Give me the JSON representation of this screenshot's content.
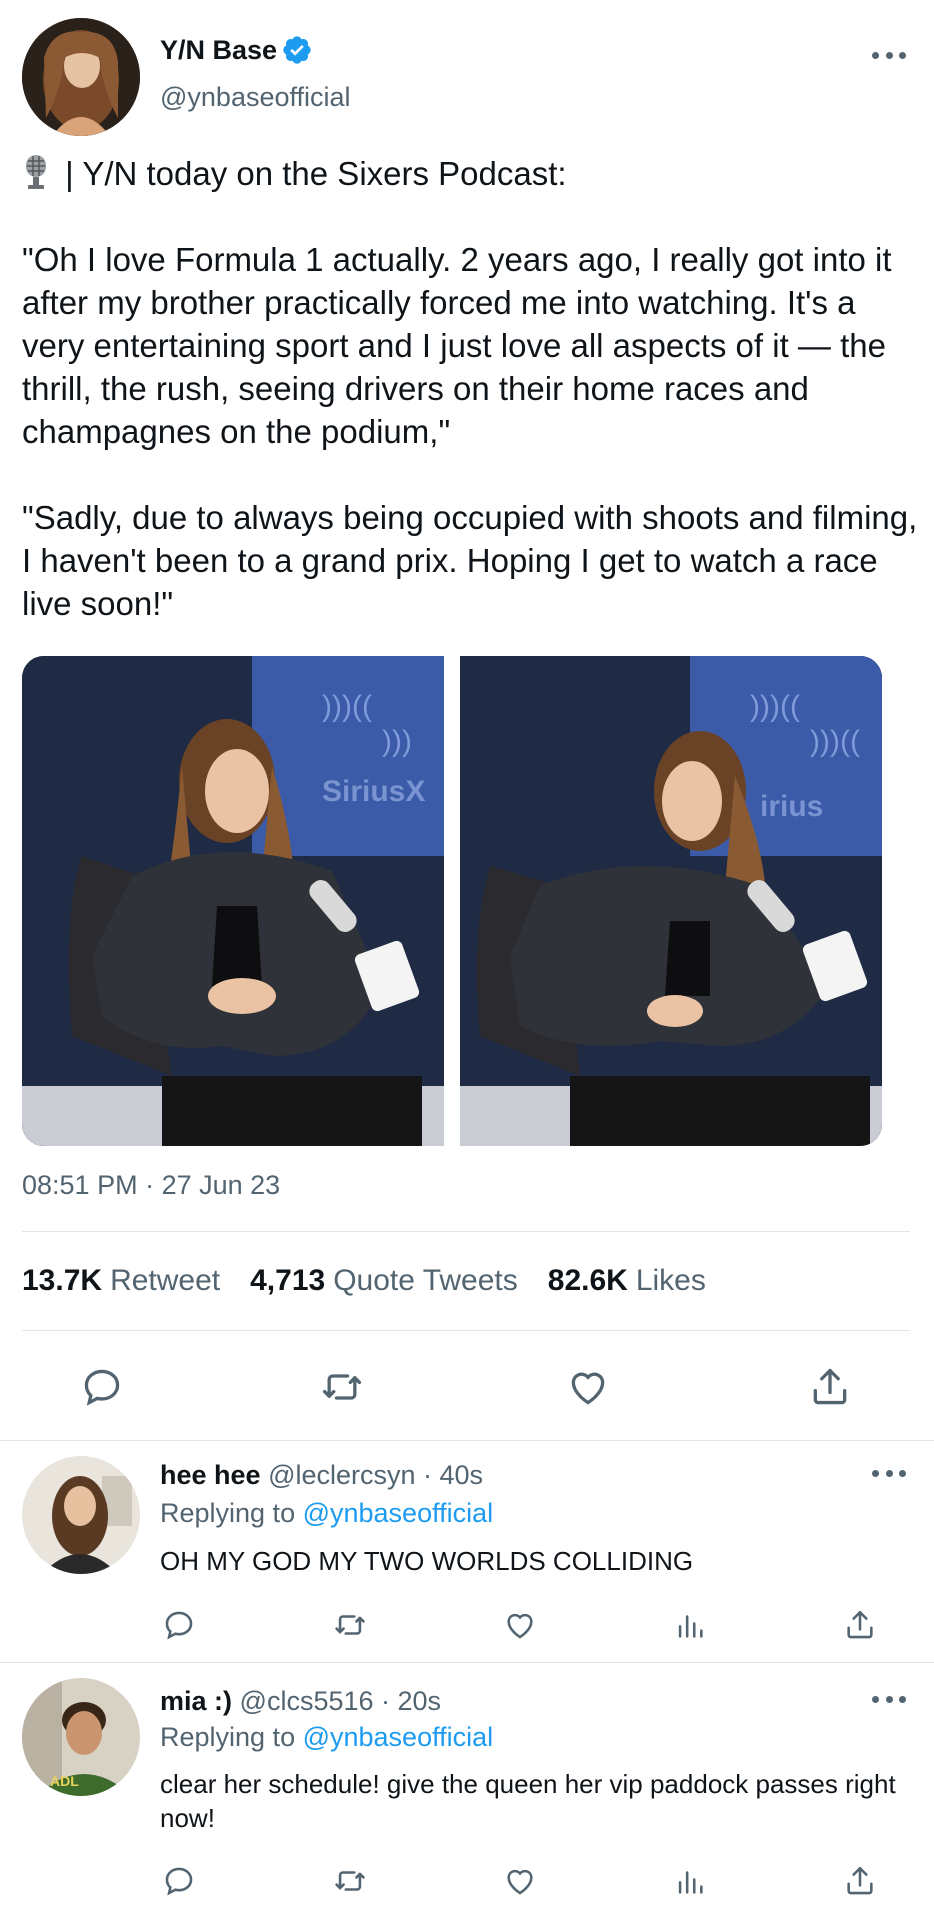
{
  "main_tweet": {
    "display_name": "Y/N Base",
    "handle": "@ynbaseofficial",
    "verified": true,
    "lead_line": " | Y/N today on the Sixers Podcast:",
    "quote_1": "\"Oh I love Formula 1 actually. 2 years ago, I really got into it after my brother practically forced me into watching. It's a very entertaining sport and I just love all aspects of it — the thrill, the rush, seeing drivers on their home races and champagnes on the podium,\"",
    "quote_2": "\"Sadly, due to always being occupied with shoots and filming, I haven't been to a grand prix. Hoping I get to watch a race live soon!\"",
    "media_overlay_text": "SiriusX",
    "time": "08:51 PM",
    "date_separator": " · ",
    "date": "27 Jun 23",
    "stats": {
      "retweets_count": "13.7K",
      "retweets_label": "Retweet",
      "quotes_count": "4,713",
      "quotes_label": "Quote Tweets",
      "likes_count": "82.6K",
      "likes_label": "Likes"
    },
    "actions": [
      "reply-icon",
      "retweet-icon",
      "like-icon",
      "share-icon"
    ]
  },
  "replies": [
    {
      "display_name": "hee hee",
      "handle": "@leclercsyn",
      "time": " · 40s",
      "replying_prefix": "Replying to ",
      "replying_to": "@ynbaseofficial",
      "text": "OH MY GOD MY TWO WORLDS COLLIDING",
      "actions": [
        "reply-icon",
        "retweet-icon",
        "like-icon",
        "analytics-icon",
        "share-icon"
      ]
    },
    {
      "display_name": "mia :)",
      "handle": "@clcs5516",
      "time": " · 20s",
      "replying_prefix": "Replying to ",
      "replying_to": "@ynbaseofficial",
      "text": "clear her schedule! give the queen her vip paddock passes right now!",
      "actions": [
        "reply-icon",
        "retweet-icon",
        "like-icon",
        "analytics-icon",
        "share-icon"
      ]
    }
  ],
  "colors": {
    "text": "#0f1419",
    "secondary": "#536471",
    "link": "#1d9bf0",
    "verified": "#1d9bf0",
    "divider": "#e1e6ea"
  }
}
